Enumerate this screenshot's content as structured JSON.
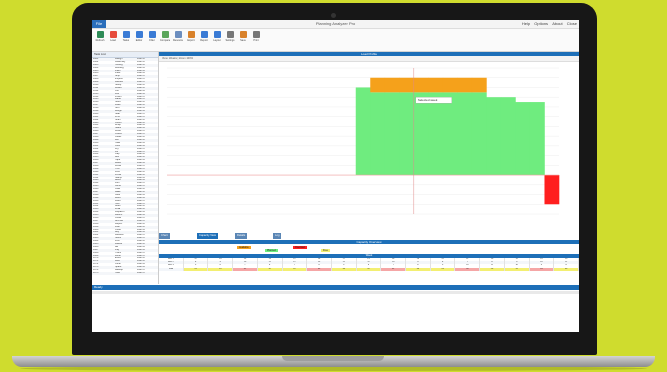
{
  "colors": {
    "background": "#cfdc2e",
    "accent": "#1d6fb8",
    "bar_orange": "#f5a11b",
    "bar_green": "#6fec7f",
    "bar_red": "#ff1f1f"
  },
  "window": {
    "title": "Planning Analyzer Pro",
    "file_tab": "File",
    "controls": [
      "Help",
      "Options",
      "About",
      "Close"
    ]
  },
  "ribbon": {
    "buttons": [
      {
        "label": "Refresh",
        "icon": "refresh-icon",
        "color": "#2e8b57"
      },
      {
        "label": "Load",
        "icon": "database-icon",
        "color": "#e64b3c"
      },
      {
        "label": "Tasks",
        "icon": "list-icon",
        "color": "#3a7bd5"
      },
      {
        "label": "Editor",
        "icon": "edit-icon",
        "color": "#3a7bd5"
      },
      {
        "label": "Filter",
        "icon": "filter-icon",
        "color": "#3a7bd5"
      },
      {
        "label": "Compare",
        "icon": "compare-icon",
        "color": "#5aa55a"
      },
      {
        "label": "Resources",
        "icon": "people-icon",
        "color": "#6c8ebf"
      },
      {
        "label": "Export",
        "icon": "export-icon",
        "color": "#d9822b"
      },
      {
        "label": "Report",
        "icon": "report-icon",
        "color": "#3a7bd5"
      },
      {
        "label": "Layout",
        "icon": "layout-icon",
        "color": "#3a7bd5"
      },
      {
        "label": "Settings",
        "icon": "gear-icon",
        "color": "#777777"
      },
      {
        "label": "Save",
        "icon": "save-icon",
        "color": "#d9822b"
      },
      {
        "label": "Print",
        "icon": "print-icon",
        "color": "#777777"
      }
    ]
  },
  "left_panel": {
    "header": "Task List",
    "columns": [
      "ID",
      "Name",
      "Group"
    ],
    "rows": [
      [
        "1001",
        "Design",
        "Plant A"
      ],
      [
        "1002",
        "Assembly",
        "Plant A"
      ],
      [
        "1003",
        "Testing",
        "Plant A"
      ],
      [
        "1004",
        "Welding",
        "Plant B"
      ],
      [
        "1005",
        "Paint",
        "Plant B"
      ],
      [
        "1006",
        "Pack",
        "Plant B"
      ],
      [
        "1007",
        "Ship",
        "Plant C"
      ],
      [
        "1008",
        "Inspect",
        "Plant C"
      ],
      [
        "1009",
        "Review",
        "Plant C"
      ],
      [
        "1010",
        "Setup",
        "Plant A"
      ],
      [
        "1011",
        "Mould",
        "Plant A"
      ],
      [
        "1012",
        "Cut",
        "Plant B"
      ],
      [
        "1013",
        "Drill",
        "Plant B"
      ],
      [
        "1014",
        "Polish",
        "Plant C"
      ],
      [
        "1015",
        "Label",
        "Plant C"
      ],
      [
        "1016",
        "Store",
        "Plant A"
      ],
      [
        "1017",
        "Load",
        "Plant A"
      ],
      [
        "1018",
        "Sort",
        "Plant B"
      ],
      [
        "1019",
        "Weigh",
        "Plant B"
      ],
      [
        "1020",
        "Seal",
        "Plant C"
      ],
      [
        "1021",
        "Print",
        "Plant C"
      ],
      [
        "1022",
        "Scan",
        "Plant A"
      ],
      [
        "1023",
        "Count",
        "Plant A"
      ],
      [
        "1024",
        "Wrap",
        "Plant B"
      ],
      [
        "1025",
        "Stack",
        "Plant B"
      ],
      [
        "1026",
        "Move",
        "Plant C"
      ],
      [
        "1027",
        "Check",
        "Plant C"
      ],
      [
        "1028",
        "Clean",
        "Plant A"
      ],
      [
        "1029",
        "Mix",
        "Plant A"
      ],
      [
        "1030",
        "Heat",
        "Plant B"
      ],
      [
        "1031",
        "Cool",
        "Plant B"
      ],
      [
        "1032",
        "Dry",
        "Plant C"
      ],
      [
        "1033",
        "Fill",
        "Plant C"
      ],
      [
        "1034",
        "Cap",
        "Plant A"
      ],
      [
        "1035",
        "Box",
        "Plant A"
      ],
      [
        "1036",
        "Tape",
        "Plant B"
      ],
      [
        "1037",
        "Wash",
        "Plant B"
      ],
      [
        "1038",
        "Rinse",
        "Plant C"
      ],
      [
        "1039",
        "Trim",
        "Plant C"
      ],
      [
        "1040",
        "Fold",
        "Plant A"
      ],
      [
        "1041",
        "Press",
        "Plant A"
      ],
      [
        "1042",
        "Stamp",
        "Plant B"
      ],
      [
        "1043",
        "Bend",
        "Plant B"
      ],
      [
        "1044",
        "Join",
        "Plant C"
      ],
      [
        "1045",
        "Grind",
        "Plant C"
      ],
      [
        "1046",
        "Coat",
        "Plant A"
      ],
      [
        "1047",
        "Bake",
        "Plant A"
      ],
      [
        "1048",
        "Glue",
        "Plant B"
      ],
      [
        "1049",
        "Weld",
        "Plant B"
      ],
      [
        "1050",
        "Feed",
        "Plant C"
      ],
      [
        "1051",
        "Test",
        "Plant C"
      ],
      [
        "1052",
        "Audit",
        "Plant A"
      ],
      [
        "1053",
        "Final",
        "Plant A"
      ],
      [
        "1054",
        "Dispatch",
        "Plant B"
      ],
      [
        "1055",
        "Return",
        "Plant B"
      ],
      [
        "1056",
        "Close",
        "Plant C"
      ],
      [
        "1057",
        "Archive",
        "Plant C"
      ],
      [
        "1058",
        "Report",
        "Plant A"
      ],
      [
        "1059",
        "Plan",
        "Plant A"
      ],
      [
        "1060",
        "Order",
        "Plant B"
      ],
      [
        "1061",
        "Buy",
        "Plant B"
      ],
      [
        "1062",
        "Receive",
        "Plant C"
      ],
      [
        "1063",
        "Stock",
        "Plant C"
      ],
      [
        "1064",
        "Pick",
        "Plant A"
      ],
      [
        "1065",
        "Deliver",
        "Plant A"
      ],
      [
        "1066",
        "Bill",
        "Plant B"
      ],
      [
        "1067",
        "Pay",
        "Plant B"
      ],
      [
        "1068",
        "Track",
        "Plant C"
      ],
      [
        "1069",
        "Done",
        "Plant C"
      ],
      [
        "1070",
        "Extra",
        "Plant A"
      ],
      [
        "1071",
        "Misc",
        "Plant A"
      ],
      [
        "1072",
        "Other",
        "Plant B"
      ],
      [
        "1073",
        "Spare",
        "Plant B"
      ],
      [
        "1074",
        "Backup",
        "Plant C"
      ],
      [
        "1075",
        "Hold",
        "Plant C"
      ]
    ]
  },
  "chart_window": {
    "title": "Load Profile",
    "toolbar_text": "View: Weeks  |  Zoom 100%",
    "tooltip": "Selected week"
  },
  "chart_data": {
    "type": "area",
    "x": [
      1,
      2,
      3,
      4,
      5,
      6,
      7,
      8,
      9,
      10,
      11,
      12,
      13,
      14,
      15,
      16,
      17,
      18,
      19,
      20,
      21,
      22,
      23,
      24,
      25,
      26,
      27
    ],
    "series": [
      {
        "color": "#6fec7f",
        "values": [
          0,
          0,
          0,
          0,
          0,
          0,
          0,
          0,
          0,
          0,
          0,
          0,
          0,
          18,
          17,
          17,
          17,
          17,
          17,
          17,
          17,
          17,
          16,
          16,
          15,
          15,
          0
        ]
      },
      {
        "color": "#f5a11b",
        "values": [
          0,
          0,
          0,
          0,
          0,
          0,
          0,
          0,
          0,
          0,
          0,
          0,
          0,
          0,
          3,
          3,
          3,
          3,
          3,
          3,
          3,
          3,
          0,
          0,
          0,
          0,
          0
        ]
      },
      {
        "color": "#ff1f1f",
        "values": [
          0,
          0,
          0,
          0,
          0,
          0,
          0,
          0,
          0,
          0,
          0,
          0,
          0,
          0,
          0,
          0,
          0,
          0,
          0,
          0,
          0,
          0,
          0,
          0,
          0,
          0,
          -6
        ]
      }
    ],
    "ylim": [
      -8,
      22
    ],
    "grid": true
  },
  "tabs": [
    "Chart",
    "Capacity View",
    "Details",
    "Log"
  ],
  "bottom_panel": {
    "title": "Capacity Overview",
    "legend": [
      {
        "label": "Available",
        "color": "#f5a11b"
      },
      {
        "label": "Planned",
        "color": "#6fec7f"
      },
      {
        "label": "Overload",
        "color": "#ff1f1f"
      },
      {
        "label": "Free",
        "color": "#f3ef72"
      }
    ],
    "grid_header": "Week",
    "grid_rows": [
      [
        "Res 1",
        "12",
        "14",
        "15",
        "13",
        "12",
        "16",
        "17",
        "15",
        "14",
        "13",
        "12",
        "11",
        "10",
        "12",
        "14",
        "15"
      ],
      [
        "Res 2",
        "8",
        "9",
        "10",
        "11",
        "12",
        "13",
        "12",
        "11",
        "10",
        "9",
        "8",
        "7",
        "8",
        "9",
        "10",
        "11"
      ],
      [
        "Res 3",
        "5",
        "6",
        "7",
        "8",
        "7",
        "6",
        "5",
        "6",
        "7",
        "8",
        "9",
        "10",
        "11",
        "10",
        "9",
        "8"
      ],
      [
        "Total",
        "25",
        "29",
        "32",
        "32",
        "31",
        "35",
        "34",
        "32",
        "31",
        "30",
        "29",
        "28",
        "29",
        "31",
        "33",
        "34"
      ]
    ]
  },
  "status": {
    "text": "Ready"
  }
}
